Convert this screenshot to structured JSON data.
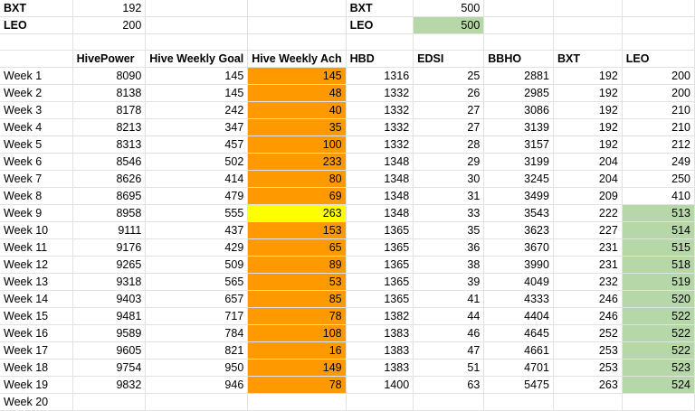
{
  "top_rows": [
    {
      "label": "BXT",
      "value": "192",
      "label2": "BXT",
      "value2": "500"
    },
    {
      "label": "LEO",
      "value": "200",
      "label2": "LEO",
      "value2": "500"
    }
  ],
  "headers": [
    "",
    "HivePower",
    "Hive Weekly Goal",
    "Hive Weekly Ach",
    "HBD",
    "EDSI",
    "BBHO",
    "BXT",
    "LEO"
  ],
  "rows": [
    [
      "Week 1",
      "8090",
      "145",
      "145",
      "1316",
      "25",
      "2881",
      "192",
      "200"
    ],
    [
      "Week 2",
      "8138",
      "145",
      "48",
      "1332",
      "26",
      "2985",
      "192",
      "200"
    ],
    [
      "Week 3",
      "8178",
      "242",
      "40",
      "1332",
      "27",
      "3086",
      "192",
      "210"
    ],
    [
      "Week 4",
      "8213",
      "347",
      "35",
      "1332",
      "27",
      "3139",
      "192",
      "210"
    ],
    [
      "Week 5",
      "8313",
      "457",
      "100",
      "1332",
      "28",
      "3157",
      "192",
      "212"
    ],
    [
      "Week 6",
      "8546",
      "502",
      "233",
      "1348",
      "29",
      "3199",
      "204",
      "249"
    ],
    [
      "Week 7",
      "8626",
      "414",
      "80",
      "1348",
      "30",
      "3245",
      "204",
      "250"
    ],
    [
      "Week 8",
      "8695",
      "479",
      "69",
      "1348",
      "31",
      "3499",
      "209",
      "410"
    ],
    [
      "Week 9",
      "8958",
      "555",
      "263",
      "1348",
      "33",
      "3543",
      "222",
      "513"
    ],
    [
      "Week 10",
      "9111",
      "437",
      "153",
      "1365",
      "35",
      "3623",
      "227",
      "514"
    ],
    [
      "Week 11",
      "9176",
      "429",
      "65",
      "1365",
      "36",
      "3670",
      "231",
      "515"
    ],
    [
      "Week 12",
      "9265",
      "509",
      "89",
      "1365",
      "38",
      "3990",
      "231",
      "518"
    ],
    [
      "Week 13",
      "9318",
      "565",
      "53",
      "1365",
      "39",
      "4049",
      "232",
      "519"
    ],
    [
      "Week 14",
      "9403",
      "657",
      "85",
      "1365",
      "41",
      "4333",
      "246",
      "520"
    ],
    [
      "Week 15",
      "9481",
      "717",
      "78",
      "1382",
      "44",
      "4404",
      "246",
      "522"
    ],
    [
      "Week 16",
      "9589",
      "784",
      "108",
      "1383",
      "46",
      "4645",
      "252",
      "522"
    ],
    [
      "Week 17",
      "9605",
      "821",
      "16",
      "1383",
      "47",
      "4661",
      "253",
      "522"
    ],
    [
      "Week 18",
      "9754",
      "950",
      "149",
      "1383",
      "51",
      "4701",
      "253",
      "523"
    ],
    [
      "Week 19",
      "9832",
      "946",
      "78",
      "1400",
      "63",
      "5475",
      "263",
      "524"
    ]
  ],
  "partial_row_label": "Week 20",
  "colors": {
    "orange": "#ff9900",
    "yellow": "#ffff00",
    "green": "#b6d7a8"
  }
}
